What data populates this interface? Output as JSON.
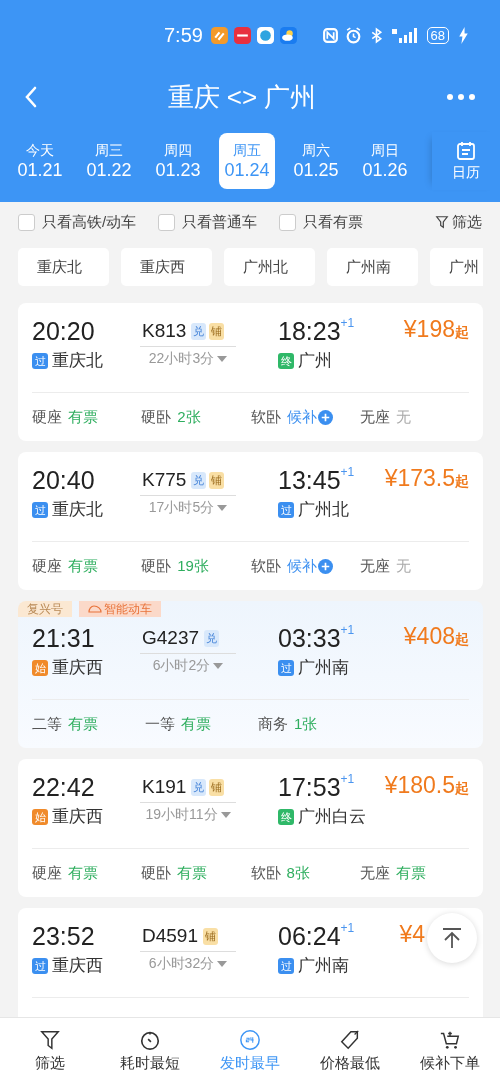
{
  "status_bar": {
    "time": "7:59",
    "battery": "68"
  },
  "header": {
    "title": "重庆 <> 广州"
  },
  "dates": [
    {
      "weekday": "今天",
      "date": "01.21",
      "selected": false
    },
    {
      "weekday": "周三",
      "date": "01.22",
      "selected": false
    },
    {
      "weekday": "周四",
      "date": "01.23",
      "selected": false
    },
    {
      "weekday": "周五",
      "date": "01.24",
      "selected": true
    },
    {
      "weekday": "周六",
      "date": "01.25",
      "selected": false
    },
    {
      "weekday": "周日",
      "date": "01.26",
      "selected": false
    }
  ],
  "calendar_label": "日历",
  "filters": [
    {
      "label": "只看高铁/动车",
      "checked": false
    },
    {
      "label": "只看普通车",
      "checked": false
    },
    {
      "label": "只看有票",
      "checked": false
    }
  ],
  "filter_button": "筛选",
  "stations": [
    "重庆北",
    "重庆西",
    "广州北",
    "广州南",
    "广州"
  ],
  "trains": [
    {
      "depart": "20:20",
      "number": "K813",
      "badges": [
        {
          "kind": "exchange",
          "text": "兑"
        },
        {
          "kind": "berth",
          "text": "铺"
        }
      ],
      "arrive": "18:23",
      "day_offset": "+1",
      "price": "¥198",
      "price_suffix": "起",
      "from_tag": {
        "kind": "pass",
        "text": "过"
      },
      "from": "重庆北",
      "duration": "22小时3分",
      "to_tag": {
        "kind": "end",
        "text": "终"
      },
      "to": "广州",
      "seats": [
        {
          "name": "硬座",
          "status": "有票",
          "kind": "available"
        },
        {
          "name": "硬卧",
          "status": "2张",
          "kind": "available"
        },
        {
          "name": "软卧",
          "status": "候补",
          "kind": "waitlist"
        },
        {
          "name": "无座",
          "status": "无",
          "kind": "none"
        }
      ]
    },
    {
      "depart": "20:40",
      "number": "K775",
      "badges": [
        {
          "kind": "exchange",
          "text": "兑"
        },
        {
          "kind": "berth",
          "text": "铺"
        }
      ],
      "arrive": "13:45",
      "day_offset": "+1",
      "price": "¥173.5",
      "price_suffix": "起",
      "from_tag": {
        "kind": "pass",
        "text": "过"
      },
      "from": "重庆北",
      "duration": "17小时5分",
      "to_tag": {
        "kind": "pass",
        "text": "过"
      },
      "to": "广州北",
      "seats": [
        {
          "name": "硬座",
          "status": "有票",
          "kind": "available"
        },
        {
          "name": "硬卧",
          "status": "19张",
          "kind": "available"
        },
        {
          "name": "软卧",
          "status": "候补",
          "kind": "waitlist"
        },
        {
          "name": "无座",
          "status": "无",
          "kind": "none"
        }
      ]
    },
    {
      "tags": [
        "复兴号",
        "智能动车"
      ],
      "depart": "21:31",
      "number": "G4237",
      "badges": [
        {
          "kind": "exchange",
          "text": "兑"
        }
      ],
      "arrive": "03:33",
      "day_offset": "+1",
      "price": "¥408",
      "price_suffix": "起",
      "from_tag": {
        "kind": "start",
        "text": "始"
      },
      "from": "重庆西",
      "duration": "6小时2分",
      "to_tag": {
        "kind": "pass",
        "text": "过"
      },
      "to": "广州南",
      "seats": [
        {
          "name": "二等",
          "status": "有票",
          "kind": "available"
        },
        {
          "name": "一等",
          "status": "有票",
          "kind": "available"
        },
        {
          "name": "商务",
          "status": "1张",
          "kind": "available"
        }
      ]
    },
    {
      "depart": "22:42",
      "number": "K191",
      "badges": [
        {
          "kind": "exchange",
          "text": "兑"
        },
        {
          "kind": "berth",
          "text": "铺"
        }
      ],
      "arrive": "17:53",
      "day_offset": "+1",
      "price": "¥180.5",
      "price_suffix": "起",
      "from_tag": {
        "kind": "start",
        "text": "始"
      },
      "from": "重庆西",
      "duration": "19小时11分",
      "to_tag": {
        "kind": "end",
        "text": "终"
      },
      "to": "广州白云",
      "seats": [
        {
          "name": "硬座",
          "status": "有票",
          "kind": "available"
        },
        {
          "name": "硬卧",
          "status": "有票",
          "kind": "available"
        },
        {
          "name": "软卧",
          "status": "8张",
          "kind": "available"
        },
        {
          "name": "无座",
          "status": "有票",
          "kind": "available"
        }
      ]
    },
    {
      "depart": "23:52",
      "number": "D4591",
      "badges": [
        {
          "kind": "berth",
          "text": "铺"
        }
      ],
      "arrive": "06:24",
      "day_offset": "+1",
      "price": "¥4",
      "from_tag": {
        "kind": "pass",
        "text": "过"
      },
      "from": "重庆西",
      "duration": "6小时32分",
      "to_tag": {
        "kind": "pass",
        "text": "过"
      },
      "to": "广州南"
    }
  ],
  "bottom_nav": [
    {
      "kind": "filter",
      "label": "筛选",
      "selected": false
    },
    {
      "kind": "duration",
      "label": "耗时最短",
      "selected": false
    },
    {
      "kind": "clock24",
      "label": "发时最早",
      "selected": true
    },
    {
      "kind": "price",
      "label": "价格最低",
      "selected": false
    },
    {
      "kind": "cart",
      "label": "候补下单",
      "selected": false
    }
  ]
}
